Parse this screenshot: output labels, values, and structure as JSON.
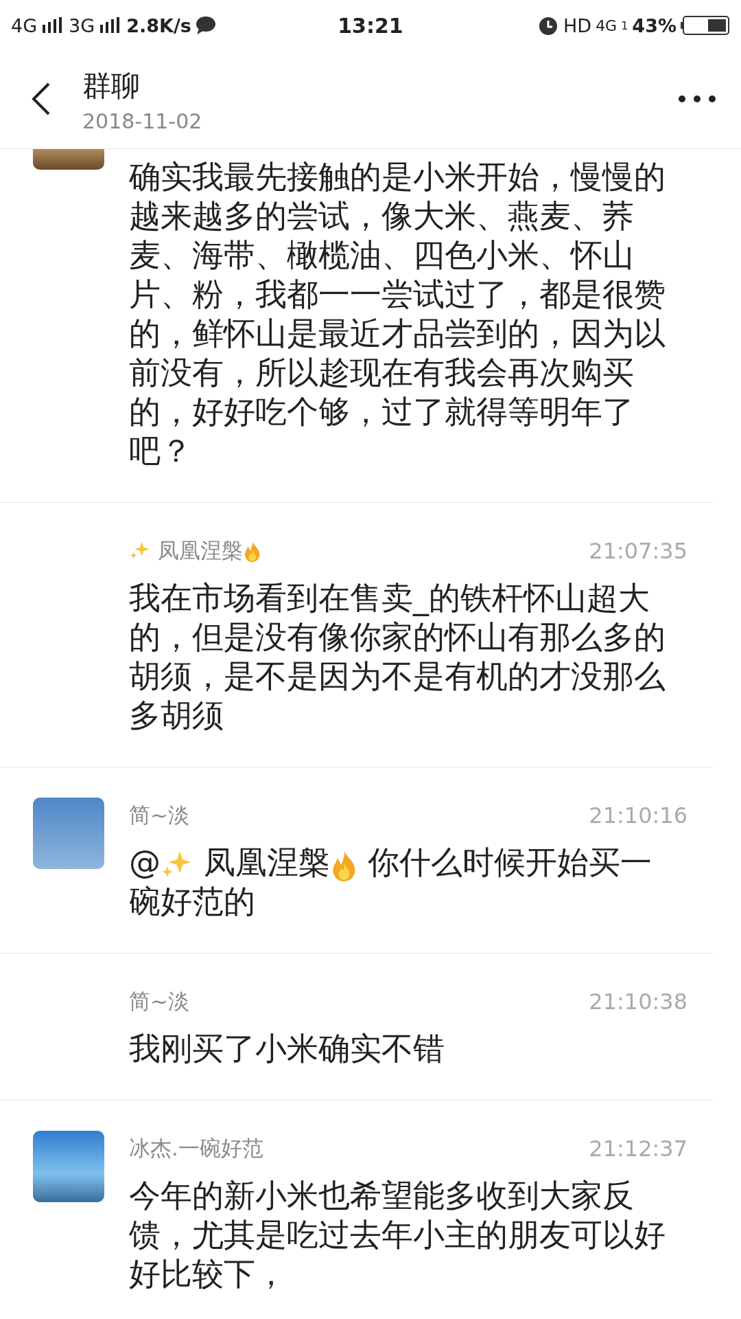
{
  "status_bar": {
    "network_1": "4G",
    "network_2": "3G",
    "speed": "2.8K/s",
    "time": "13:21",
    "hd": "HD",
    "network_3": "4G",
    "sim": "1",
    "battery": "43%"
  },
  "header": {
    "title": "群聊",
    "subtitle": "2018-11-02"
  },
  "messages": [
    {
      "avatar": true,
      "avatar_cut": true,
      "body": [
        {
          "kind": "text",
          "text": "确实我最先接触的是小米开始，慢慢的越来越多的尝试，像大米、燕麦、荞麦、海带、橄榄油、四色小米、怀山片、粉，我都一一尝试过了，都是很赞的，鲜怀山是最近才品尝到的，因为以前没有，所以趁现在有我会再次购买的，好好吃个够，过了就得等明年了吧？"
        }
      ]
    },
    {
      "name": [
        {
          "kind": "sparkle"
        },
        {
          "kind": "text",
          "text": " 凤凰涅槃"
        },
        {
          "kind": "flame"
        }
      ],
      "time": "21:07:35",
      "body": [
        {
          "kind": "text",
          "text": "我在市场看到在售卖_的铁杆怀山超大的，但是没有像你家的怀山有那么多的胡须，是不是因为不是有机的才没那么多胡须"
        }
      ]
    },
    {
      "avatar": true,
      "avatar_cut": false,
      "name": [
        {
          "kind": "text",
          "text": "简~淡"
        }
      ],
      "time": "21:10:16",
      "body": [
        {
          "kind": "text",
          "text": "@"
        },
        {
          "kind": "sparkle"
        },
        {
          "kind": "text",
          "text": " 凤凰涅槃"
        },
        {
          "kind": "flame"
        },
        {
          "kind": "text",
          "text": " 你什么时候开始买一"
        },
        {
          "kind": "text",
          "text": "碗好范的"
        }
      ]
    },
    {
      "name": [
        {
          "kind": "text",
          "text": "简~淡"
        }
      ],
      "time": "21:10:38",
      "body": [
        {
          "kind": "text",
          "text": "我刚买了小米确实不错"
        }
      ]
    },
    {
      "avatar": true,
      "avatar_cut": false,
      "name": [
        {
          "kind": "text",
          "text": "冰杰.一碗好范"
        }
      ],
      "time": "21:12:37",
      "body": [
        {
          "kind": "text",
          "text": "今年的新小米也希望能多收到大家反馈，尤其是吃过去年小主的朋友可以好好比较下，"
        }
      ]
    }
  ]
}
